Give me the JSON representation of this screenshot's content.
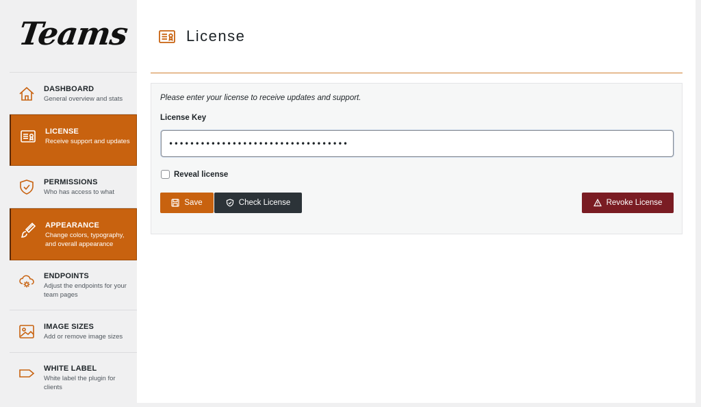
{
  "app": {
    "logo": "Teams"
  },
  "sidebar": {
    "items": [
      {
        "title": "DASHBOARD",
        "subtitle": "General overview and stats",
        "icon": "home-icon"
      },
      {
        "title": "LICENSE",
        "subtitle": "Receive support and updates",
        "icon": "license-card-icon",
        "active": true
      },
      {
        "title": "PERMISSIONS",
        "subtitle": "Who has access to what",
        "icon": "shield-check-icon"
      },
      {
        "title": "APPEARANCE",
        "subtitle": "Change colors, typography, and overall appearance",
        "icon": "paint-brush-icon",
        "active": true
      },
      {
        "title": "ENDPOINTS",
        "subtitle": "Adjust the endpoints for your team pages",
        "icon": "cloud-gear-icon"
      },
      {
        "title": "IMAGE SIZES",
        "subtitle": "Add or remove image sizes",
        "icon": "image-icon"
      },
      {
        "title": "WHITE LABEL",
        "subtitle": "White label the plugin for clients",
        "icon": "tag-icon"
      }
    ]
  },
  "page": {
    "title": "License",
    "intro": "Please enter your license to receive updates and support.",
    "license_key_label": "License Key",
    "license_key_value": "••••••••••••••••••••••••••••••••••",
    "reveal_label": "Reveal license",
    "reveal_checked": false,
    "buttons": {
      "save": "Save",
      "check": "Check License",
      "revoke": "Revoke License"
    }
  },
  "colors": {
    "accent": "#c8620f",
    "dark_button": "#2c3338",
    "danger": "#7a1c23"
  }
}
